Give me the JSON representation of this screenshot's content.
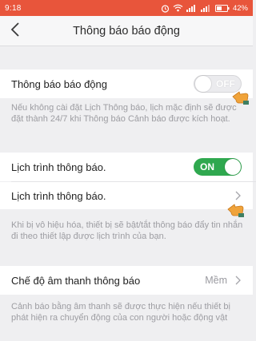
{
  "status_bar": {
    "time": "9:18",
    "battery": "42%"
  },
  "nav": {
    "title": "Thông báo báo động"
  },
  "alarm_notification": {
    "label": "Thông báo báo động",
    "toggle_text": "OFF"
  },
  "alarm_hint": "Nếu không cài đặt Lịch Thông báo, lịch mặc định sẽ được đặt thành 24/7 khi Thông báo Cảnh báo được kích hoạt.",
  "schedule_toggle": {
    "label": "Lịch trình thông báo.",
    "toggle_text": "ON"
  },
  "schedule_link": {
    "label": "Lịch trình thông báo."
  },
  "schedule_hint": "Khi bị vô hiệu hóa, thiết bị sẽ bật/tắt thông báo đẩy tin nhắn đi theo thiết lập được lịch trình của bạn.",
  "sound_mode": {
    "label": "Chế độ âm thanh thông báo",
    "value": "Mềm"
  },
  "sound_hint": "Cảnh báo bằng âm thanh sẽ được thực hiện nếu thiết bị phát hiện ra chuyển động của con người hoặc động vật",
  "colors": {
    "status_bar": "#e8553b",
    "toggle_on": "#2fa84f",
    "hint_text": "#9d9da2",
    "background": "#efeff1"
  }
}
